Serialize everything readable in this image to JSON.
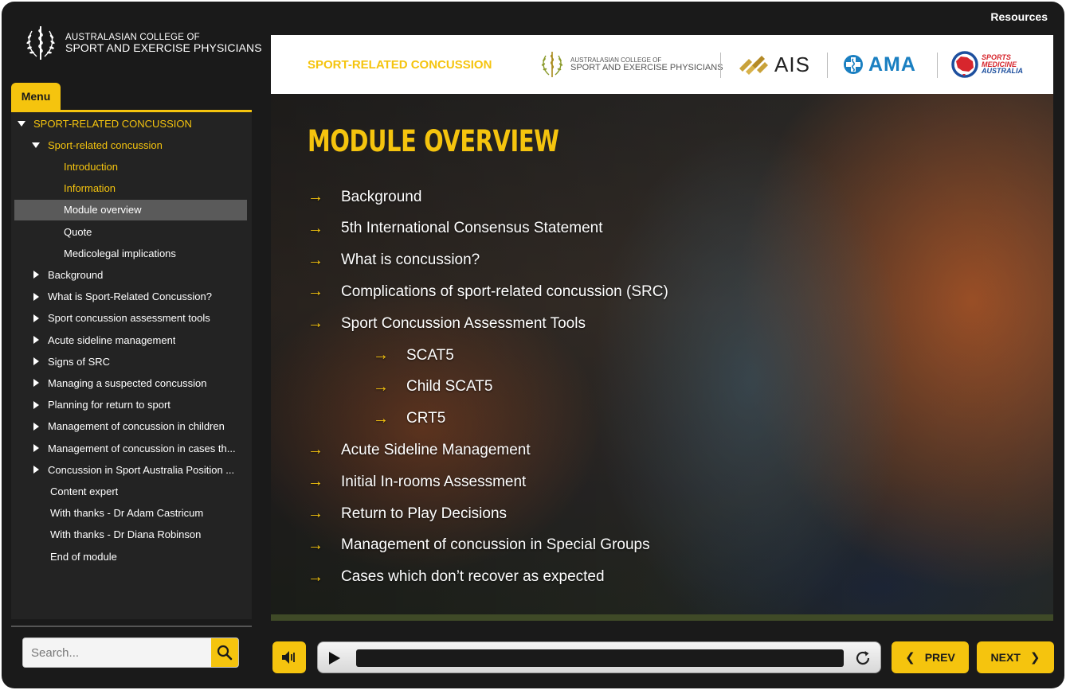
{
  "brand": {
    "line1": "AUSTRALASIAN COLLEGE OF",
    "line2": "SPORT AND EXERCISE PHYSICIANS"
  },
  "top_links": {
    "resources": "Resources"
  },
  "menu": {
    "tab_label": "Menu",
    "items": [
      {
        "label": "SPORT-RELATED CONCUSSION",
        "level": 0,
        "state": "expanded",
        "style": "gold"
      },
      {
        "label": "Sport-related concussion",
        "level": 1,
        "state": "expanded",
        "style": "gold"
      },
      {
        "label": "Introduction",
        "level": 2,
        "state": "leaf",
        "style": "gold"
      },
      {
        "label": "Information",
        "level": 2,
        "state": "leaf",
        "style": "gold"
      },
      {
        "label": "Module overview",
        "level": 2,
        "state": "leaf",
        "style": "active"
      },
      {
        "label": "Quote",
        "level": 2,
        "state": "leaf",
        "style": "normal"
      },
      {
        "label": "Medicolegal implications",
        "level": 2,
        "state": "leaf",
        "style": "normal"
      },
      {
        "label": "Background",
        "level": 1,
        "state": "collapsed",
        "style": "normal"
      },
      {
        "label": "What is Sport-Related Concussion?",
        "level": 1,
        "state": "collapsed",
        "style": "normal"
      },
      {
        "label": "Sport concussion assessment tools",
        "level": 1,
        "state": "collapsed",
        "style": "normal"
      },
      {
        "label": "Acute sideline management",
        "level": 1,
        "state": "collapsed",
        "style": "normal"
      },
      {
        "label": "Signs of SRC",
        "level": 1,
        "state": "collapsed",
        "style": "normal"
      },
      {
        "label": "Managing a suspected concussion",
        "level": 1,
        "state": "collapsed",
        "style": "normal"
      },
      {
        "label": "Planning for return to sport",
        "level": 1,
        "state": "collapsed",
        "style": "normal"
      },
      {
        "label": "Management of concussion in children",
        "level": 1,
        "state": "collapsed",
        "style": "normal"
      },
      {
        "label": "Management of concussion in cases th...",
        "level": 1,
        "state": "collapsed",
        "style": "normal"
      },
      {
        "label": "Concussion in Sport Australia Position ...",
        "level": 1,
        "state": "collapsed",
        "style": "normal"
      },
      {
        "label": "Content expert",
        "level": 1,
        "state": "leaf",
        "style": "normal"
      },
      {
        "label": "With thanks - Dr Adam Castricum",
        "level": 1,
        "state": "leaf",
        "style": "normal"
      },
      {
        "label": "With thanks - Dr Diana Robinson",
        "level": 1,
        "state": "leaf",
        "style": "normal"
      },
      {
        "label": "End of module",
        "level": 1,
        "state": "leaf",
        "style": "normal"
      }
    ]
  },
  "search": {
    "placeholder": "Search..."
  },
  "header": {
    "course_title": "SPORT-RELATED CONCUSSION",
    "logos": {
      "acsep_line1": "AUSTRALASIAN COLLEGE OF",
      "acsep_line2": "SPORT AND EXERCISE PHYSICIANS",
      "ais": "AIS",
      "ama": "AMA",
      "sma_line1": "SPORTS",
      "sma_line2": "MEDICINE",
      "sma_line3": "AUSTRALIA"
    }
  },
  "slide": {
    "title": "MODULE OVERVIEW",
    "items": [
      {
        "text": "Background",
        "indent": 0
      },
      {
        "text": "5th International Consensus Statement",
        "indent": 0
      },
      {
        "text": "What is concussion?",
        "indent": 0
      },
      {
        "text": "Complications of sport-related concussion (SRC)",
        "indent": 0
      },
      {
        "text": "Sport Concussion Assessment Tools",
        "indent": 0
      },
      {
        "text": "SCAT5",
        "indent": 1
      },
      {
        "text": "Child SCAT5",
        "indent": 1
      },
      {
        "text": "CRT5",
        "indent": 1
      },
      {
        "text": "Acute Sideline Management",
        "indent": 0
      },
      {
        "text": "Initial In-rooms Assessment",
        "indent": 0
      },
      {
        "text": "Return to Play Decisions",
        "indent": 0
      },
      {
        "text": "Management of concussion in Special Groups",
        "indent": 0
      },
      {
        "text": "Cases which don’t recover as expected",
        "indent": 0
      }
    ]
  },
  "player": {
    "progress": 0
  },
  "navigation": {
    "prev_label": "PREV",
    "next_label": "NEXT"
  },
  "colors": {
    "accent": "#f5c40e",
    "frame": "#1a1a1a",
    "sidebar": "#232323",
    "active_row": "#5a5a5a"
  }
}
